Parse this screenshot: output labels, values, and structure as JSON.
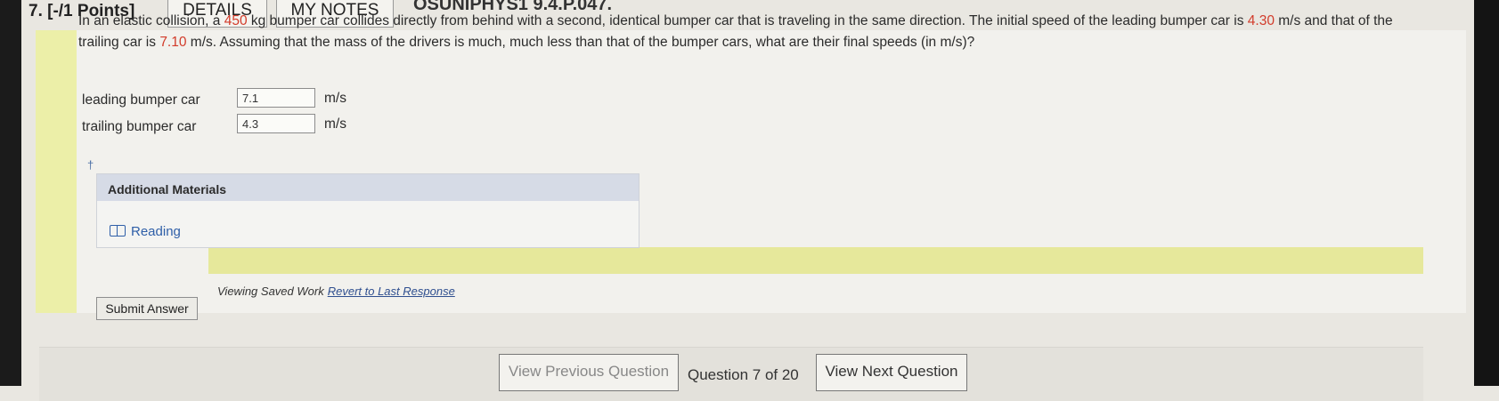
{
  "header": {
    "question_number": "7. [-/1 Points]",
    "tabs": [
      "DETAILS",
      "MY NOTES"
    ],
    "problem_code": "OSUNIPHYS1 9.4.P.047."
  },
  "question": {
    "parts": [
      "In an elastic collision, a ",
      "450",
      " kg bumper car collides directly from behind with a second, identical bumper car that is traveling in the same direction. The initial speed of the leading bumper car is ",
      "4.30",
      " m/s and that of the trailing car is ",
      "7.10",
      " m/s. Assuming that the mass of the drivers is much, much less than that of the bumper cars, what are their final speeds (in m/s)?"
    ]
  },
  "answers": [
    {
      "label": "leading bumper car",
      "value": "7.1",
      "unit": "m/s"
    },
    {
      "label": "trailing bumper car",
      "value": "4.3",
      "unit": "m/s"
    }
  ],
  "dagger": "†",
  "additional_materials": {
    "title": "Additional Materials",
    "link": "Reading"
  },
  "submit_label": "Submit Answer",
  "status": {
    "text": "Viewing Saved Work",
    "link": "Revert to Last Response"
  },
  "navigation": {
    "prev": "View Previous Question",
    "count": "Question 7 of 20",
    "next": "View Next Question"
  },
  "colors": {
    "highlight_red": "#d23b2a",
    "sidebar_yellow": "#ecefa8",
    "link_blue": "#2f5fa8"
  }
}
